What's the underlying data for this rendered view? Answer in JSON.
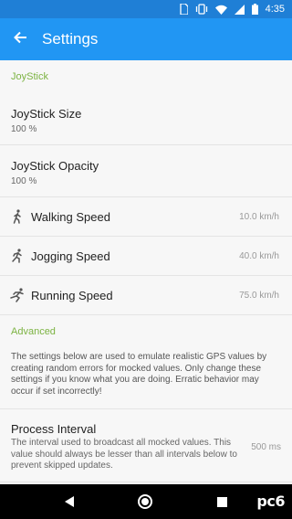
{
  "status_bar": {
    "time": "4:35",
    "icons": [
      "sim-card-icon",
      "vibrate-icon",
      "wifi-icon",
      "signal-icon",
      "battery-icon"
    ]
  },
  "app_bar": {
    "title": "Settings",
    "back_icon": "arrow-back-icon",
    "color": "#2196f3"
  },
  "sections": {
    "joystick": {
      "header": "JoyStick",
      "size": {
        "title": "JoyStick Size",
        "value": "100 %"
      },
      "opacity": {
        "title": "JoyStick Opacity",
        "value": "100 %"
      },
      "walking": {
        "title": "Walking Speed",
        "value": "10.0 km/h",
        "icon": "walking-icon"
      },
      "jogging": {
        "title": "Jogging Speed",
        "value": "40.0 km/h",
        "icon": "jogging-icon"
      },
      "running": {
        "title": "Running Speed",
        "value": "75.0 km/h",
        "icon": "running-icon"
      }
    },
    "advanced": {
      "header": "Advanced",
      "info": "The settings below are used to emulate realistic GPS values by creating random errors for mocked values. Only change these settings if you know what you are doing. Erratic behavior may occur if set incorrectly!",
      "process_interval": {
        "title": "Process Interval",
        "summary": "The interval used to broadcast all mocked values. This value should always be lesser than all intervals below to prevent skipped updates.",
        "value": "500 ms"
      }
    }
  },
  "accent_color": "#7cb342",
  "nav_bar": {
    "icons": [
      "nav-back-icon",
      "nav-home-icon",
      "nav-recents-icon"
    ]
  },
  "watermark": "pc6"
}
